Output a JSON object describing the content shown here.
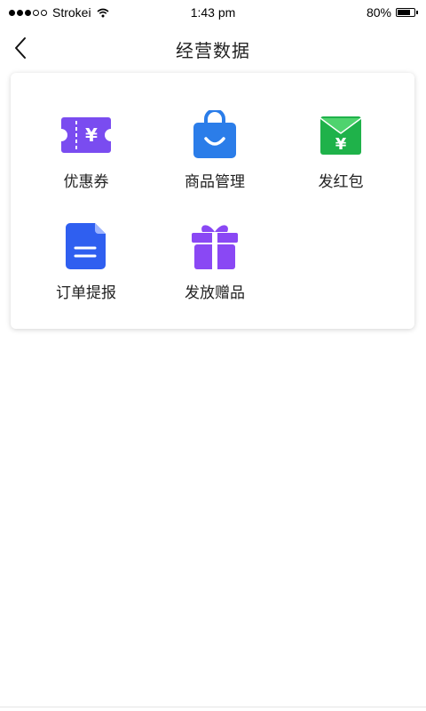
{
  "status_bar": {
    "carrier": "Strokei",
    "time": "1:43 pm",
    "battery": "80%",
    "battery_level": 0.8,
    "signal_bars_filled": 3,
    "signal_bars_total": 5
  },
  "nav": {
    "title": "经营数据",
    "back_icon": "chevron-left-icon"
  },
  "grid": {
    "items": [
      {
        "label": "优惠券",
        "icon": "coupon-icon",
        "color": "#7a4cf0"
      },
      {
        "label": "商品管理",
        "icon": "shopping-bag-icon",
        "color": "#2b7de9"
      },
      {
        "label": "发红包",
        "icon": "red-envelope-icon",
        "color": "#1fb24a"
      },
      {
        "label": "订单提报",
        "icon": "document-icon",
        "color": "#2f5ff0"
      },
      {
        "label": "发放赠品",
        "icon": "gift-icon",
        "color": "#8a48f4"
      }
    ]
  }
}
